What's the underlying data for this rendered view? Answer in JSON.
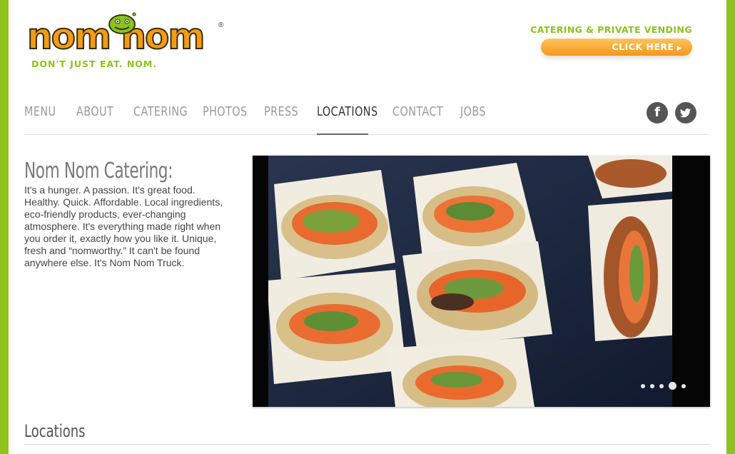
{
  "brand": {
    "logo_text": "nom nom",
    "registered_mark": "®",
    "tagline": "DON'T JUST EAT. NOM."
  },
  "cta": {
    "label": "CATERING & PRIVATE VENDING",
    "button_label": "CLICK HERE",
    "arrow": "▶"
  },
  "nav": {
    "items": [
      {
        "label": "MENU"
      },
      {
        "label": "ABOUT"
      },
      {
        "label": "CATERING"
      },
      {
        "label": "PHOTOS"
      },
      {
        "label": "PRESS"
      },
      {
        "label": "LOCATIONS"
      },
      {
        "label": "CONTACT"
      },
      {
        "label": "JOBS"
      }
    ],
    "active": "LOCATIONS",
    "social": {
      "facebook": "f",
      "twitter_icon": "twitter-bird"
    }
  },
  "content": {
    "heading": "Nom Nom Catering:",
    "intro": "It's a hunger. A passion. It's great food. Healthy. Quick. Affordable. Local ingredients, eco-friendly products, ever-changing atmosphere. It's everything made right when you order it, exactly how you like it. Unique, fresh and “nomworthy.” It can't be found anywhere else. It's Nom Nom Truck."
  },
  "slideshow": {
    "slide_count": 5,
    "active_slide": 4
  },
  "locations": {
    "title": "Locations"
  },
  "colors": {
    "brand_green": "#8dc21f",
    "brand_orange": "#f7961e",
    "nav_inactive": "#9a9a9a",
    "nav_active": "#333333"
  }
}
